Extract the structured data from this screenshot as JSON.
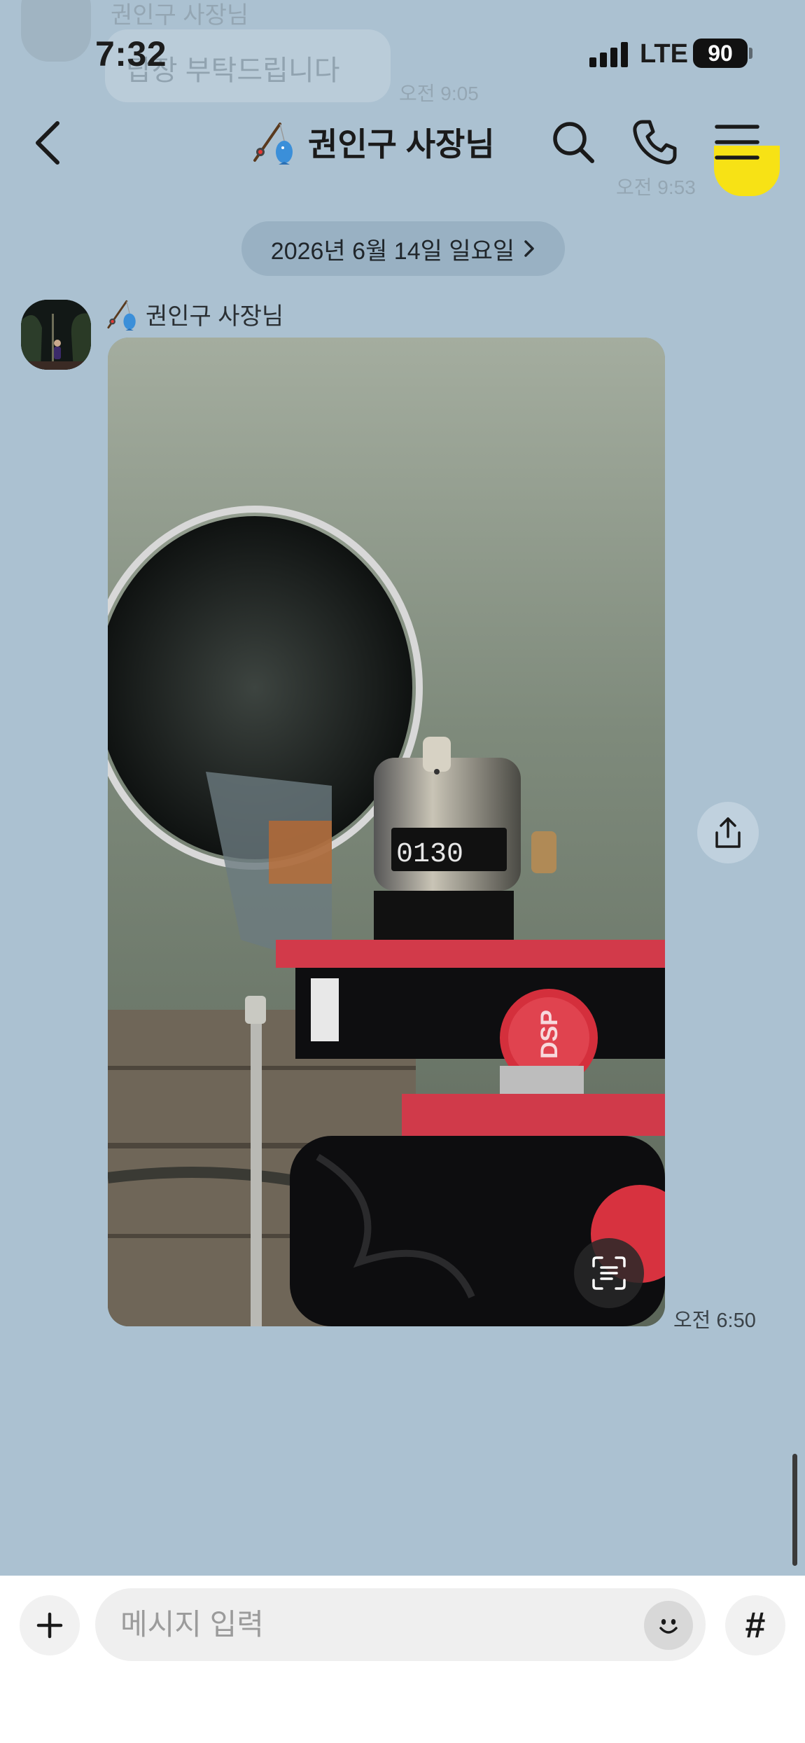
{
  "status_bar": {
    "time": "7:32",
    "network": "LTE",
    "battery": "90"
  },
  "ghost": {
    "name": "권인구 사장님",
    "message": "답장 부탁드립니다",
    "time_1": "오전 9:05",
    "time_2": "오전 9:53"
  },
  "header": {
    "title": "권인구 사장님",
    "title_icon": "fishing-rod-fish-emoji",
    "back_icon": "chevron-left-icon",
    "search_icon": "search-icon",
    "call_icon": "phone-icon",
    "menu_icon": "hamburger-menu-icon"
  },
  "date_divider": {
    "label": "2026년 6월 14일 일요일"
  },
  "message": {
    "sender": "권인구 사장님",
    "type": "photo",
    "photo_counter_digits": "0130",
    "photo_brand_text": "DSP",
    "time": "오전 6:50"
  },
  "composer": {
    "placeholder": "메시지 입력",
    "plus_icon": "plus-icon",
    "emoji_icon": "emoji-smile-icon",
    "hash_label": "#"
  },
  "colors": {
    "chat_background": "#abc1d1",
    "composer_background": "#ffffff",
    "input_background": "#efefef"
  }
}
